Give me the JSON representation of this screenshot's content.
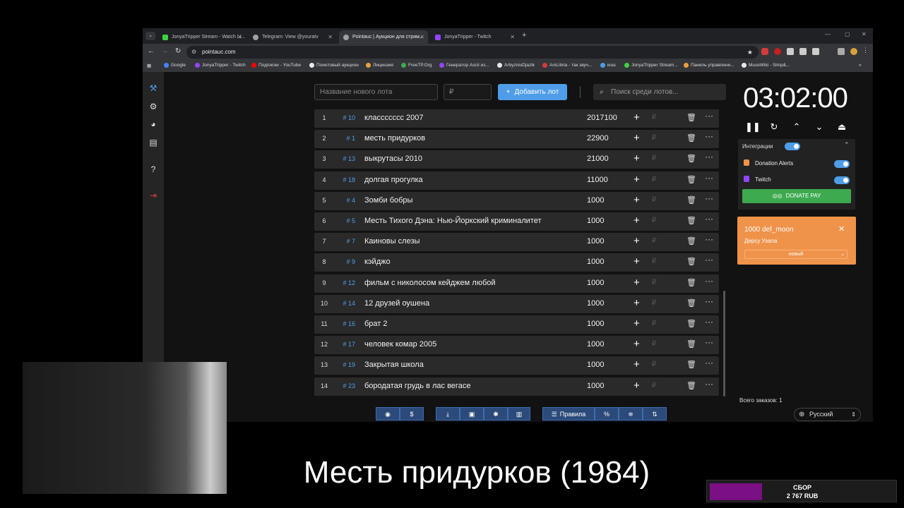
{
  "browser": {
    "tabs": [
      {
        "label": "JonyaTripper Stream - Watch Li...",
        "color": "#3fd13f"
      },
      {
        "label": "Telegram: View @youratv",
        "color": "#9aa0a6"
      },
      {
        "label": "Pointauc | Аукцион для стрим...",
        "color": "#9aa0a6"
      },
      {
        "label": "JonyaTripper - Twitch",
        "color": "#9146ff"
      }
    ],
    "new_tab": "+",
    "url": "pointauc.com",
    "bookmarks": [
      {
        "label": "Google",
        "color": "#4285f4"
      },
      {
        "label": "JonyaTripper - Twitch",
        "color": "#9146ff"
      },
      {
        "label": "Подписки - YouTube",
        "color": "#ff0000"
      },
      {
        "label": "Поинтовый аукцион",
        "color": "#e8e8e8"
      },
      {
        "label": "Лицензия",
        "color": "#e8a33a"
      },
      {
        "label": "FreeTP.Org",
        "color": "#3daa4f"
      },
      {
        "label": "Генератор Ascii из...",
        "color": "#9146ff"
      },
      {
        "label": "ArbyzniuDjazik",
        "color": "#e8e8e8"
      },
      {
        "label": "AniLibria - так звуч...",
        "color": "#d63a3a"
      },
      {
        "label": "кош",
        "color": "#4f9de8"
      },
      {
        "label": "JonyaTripper Stream...",
        "color": "#3fd13f"
      },
      {
        "label": "Панель управлени...",
        "color": "#e8a33a"
      },
      {
        "label": "MuseWiki - Simp&...",
        "color": "#e8e8e8"
      }
    ]
  },
  "controls": {
    "lot_name_placeholder": "Название нового лота",
    "price_placeholder": "₽",
    "add_button": "Добавить лот",
    "search_placeholder": "Поиск среди лотов..."
  },
  "lots": [
    {
      "idx": "1",
      "num": "# 10",
      "name": "классссссс 2007",
      "amount": "2017100"
    },
    {
      "idx": "2",
      "num": "# 1",
      "name": "месть придурков",
      "amount": "22900"
    },
    {
      "idx": "3",
      "num": "# 13",
      "name": "выкрутасы 2010",
      "amount": "21000"
    },
    {
      "idx": "4",
      "num": "# 18",
      "name": "долгая прогулка",
      "amount": "11000"
    },
    {
      "idx": "5",
      "num": "# 4",
      "name": "Зомби бобры",
      "amount": "1000"
    },
    {
      "idx": "6",
      "num": "# 5",
      "name": "Месть Тихого Дэна: Нью-Йоркский криминалитет",
      "amount": "1000"
    },
    {
      "idx": "7",
      "num": "# 7",
      "name": "Каиновы слезы",
      "amount": "1000"
    },
    {
      "idx": "8",
      "num": "# 9",
      "name": "кэйджо",
      "amount": "1000"
    },
    {
      "idx": "9",
      "num": "# 12",
      "name": "фильм с николосом кейджем любой",
      "amount": "1000"
    },
    {
      "idx": "10",
      "num": "# 14",
      "name": "12 друзей оушена",
      "amount": "1000"
    },
    {
      "idx": "11",
      "num": "# 16",
      "name": "брат 2",
      "amount": "1000"
    },
    {
      "idx": "12",
      "num": "# 17",
      "name": "человек комар 2005",
      "amount": "1000"
    },
    {
      "idx": "13",
      "num": "# 19",
      "name": "Закрытая школа",
      "amount": "1000"
    },
    {
      "idx": "14",
      "num": "# 23",
      "name": "бородатая грудь в лас вегасе",
      "amount": "1000"
    }
  ],
  "row_symbols": {
    "plus": "+",
    "currency": "₽",
    "more": "···"
  },
  "bottom_toolbar": {
    "rules": "Правила",
    "dollar": "$",
    "percent": "%"
  },
  "timer": "03:02:00",
  "integrations": {
    "title": "Интеграции",
    "items": [
      {
        "label": "Donation Alerts",
        "color": "#f0934a"
      },
      {
        "label": "Twitch",
        "color": "#9146ff"
      }
    ],
    "donate_button": "DONATE PAY"
  },
  "donation_card": {
    "title": "1000 def_moon",
    "message": "Дерсу Узала",
    "select_value": "новый"
  },
  "total_orders": "Всего заказов: 1",
  "language": "Русский",
  "caption": "Месть придурков (1984)",
  "donation_bar": {
    "line1": "СБОР",
    "line2": "2 767 RUB",
    "fill_color": "#7b1085"
  }
}
